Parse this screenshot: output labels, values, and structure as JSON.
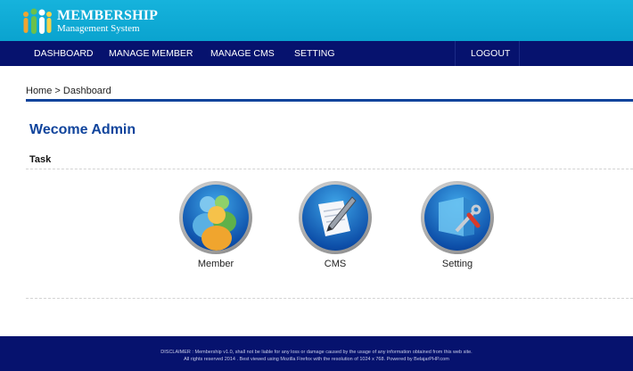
{
  "brand": {
    "title": "MEMBERSHIP",
    "subtitle": "Management System"
  },
  "nav": {
    "dashboard": "DASHBOARD",
    "manage_member": "MANAGE MEMBER",
    "manage_cms": "MANAGE CMS",
    "setting": "SETTING",
    "logout": "LOGOUT"
  },
  "breadcrumb": {
    "home": "Home",
    "separator": " > ",
    "current": "Dashboard"
  },
  "main": {
    "title": "Wecome Admin",
    "section_label": "Task",
    "tasks": [
      {
        "label": "Member",
        "icon": "users-icon"
      },
      {
        "label": "CMS",
        "icon": "pen-document-icon"
      },
      {
        "label": "Setting",
        "icon": "tools-icon"
      }
    ]
  },
  "footer": {
    "line1": "DISCLAIMER : Membership v1.0, shall not be liable for any loss or damage caused by the usage of any information obtained from this web site.",
    "line2": "All rights reserved 2014 . Best viewed using Mozilla Firefox with the resolution of 1024 x 768. Powered by BelajarPHP.com"
  },
  "colors": {
    "header_bg": "#0aa3cf",
    "nav_bg": "#06126e",
    "accent": "#10449c"
  }
}
